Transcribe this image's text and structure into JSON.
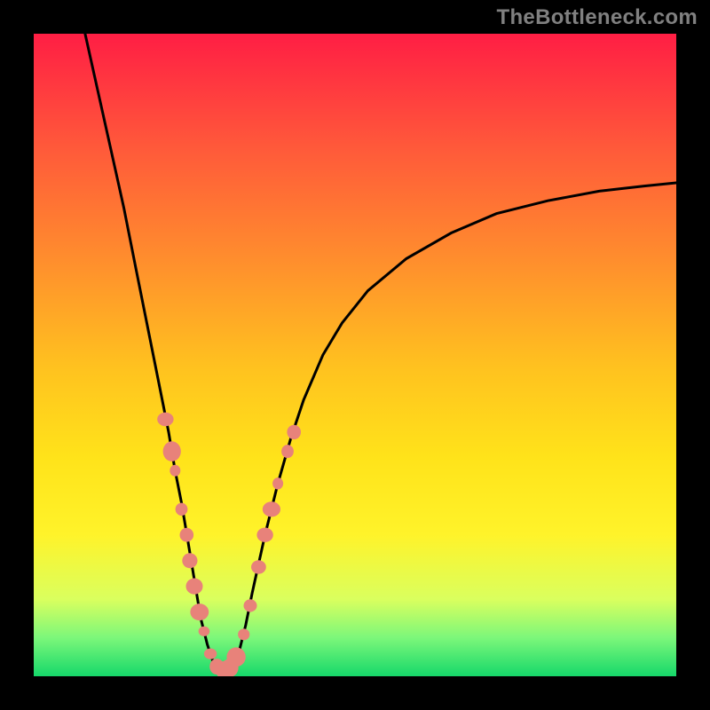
{
  "watermark": "TheBottleneck.com",
  "colors": {
    "marker": "#e8827a",
    "stroke": "#000000",
    "gradient_top": "#ff1e44",
    "gradient_bottom": "#16d86a"
  },
  "chart_data": {
    "type": "line",
    "title": "",
    "xlabel": "",
    "ylabel": "",
    "xlim": [
      0,
      100
    ],
    "ylim": [
      0,
      100
    ],
    "series": [
      {
        "name": "bottleneck-curve",
        "x": [
          8,
          10,
          12,
          14,
          16,
          18,
          20,
          21,
          22,
          23,
          24,
          25,
          26,
          27,
          28,
          29,
          30,
          31,
          32,
          33,
          34,
          36,
          38,
          40,
          42,
          45,
          48,
          52,
          58,
          65,
          72,
          80,
          88,
          95,
          100
        ],
        "y": [
          100,
          91,
          82,
          73,
          63,
          53,
          43,
          38,
          32,
          27,
          21,
          15,
          9,
          5,
          2,
          1,
          1,
          2,
          4,
          8,
          13,
          22,
          30,
          37,
          43,
          50,
          55,
          60,
          65,
          69,
          72,
          74,
          75.5,
          76.3,
          76.8
        ]
      }
    ],
    "markers": {
      "name": "highlight-points",
      "points": [
        {
          "x": 20.5,
          "y": 40
        },
        {
          "x": 21.5,
          "y": 35
        },
        {
          "x": 22.0,
          "y": 32
        },
        {
          "x": 23.0,
          "y": 26
        },
        {
          "x": 23.8,
          "y": 22
        },
        {
          "x": 24.3,
          "y": 18
        },
        {
          "x": 25.0,
          "y": 14
        },
        {
          "x": 25.8,
          "y": 10
        },
        {
          "x": 26.5,
          "y": 7
        },
        {
          "x": 27.5,
          "y": 3.5
        },
        {
          "x": 28.5,
          "y": 1.5
        },
        {
          "x": 29.5,
          "y": 1.0
        },
        {
          "x": 30.5,
          "y": 1.3
        },
        {
          "x": 31.5,
          "y": 3.0
        },
        {
          "x": 32.7,
          "y": 6.5
        },
        {
          "x": 33.7,
          "y": 11
        },
        {
          "x": 35.0,
          "y": 17
        },
        {
          "x": 36.0,
          "y": 22
        },
        {
          "x": 37.0,
          "y": 26
        },
        {
          "x": 38.0,
          "y": 30
        },
        {
          "x": 39.5,
          "y": 35
        },
        {
          "x": 40.5,
          "y": 38
        }
      ],
      "radius_range": [
        6,
        11
      ]
    }
  }
}
